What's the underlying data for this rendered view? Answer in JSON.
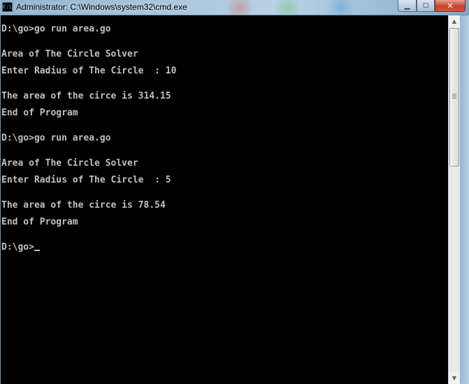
{
  "window": {
    "title": "Administrator: C:\\Windows\\system32\\cmd.exe",
    "icon_text": "C:\\",
    "controls": {
      "minimize": "▁",
      "maximize": "▢",
      "close": "✕"
    }
  },
  "console": {
    "lines": [
      "D:\\go>go run area.go",
      "Area of The Circle Solver",
      "Enter Radius of The Circle  : 10",
      "The area of the circe is 314.15",
      "End of Program",
      "D:\\go>go run area.go",
      "Area of The Circle Solver",
      "Enter Radius of The Circle  : 5",
      "The area of the circe is 78.54",
      "End of Program",
      "D:\\go>"
    ]
  },
  "scrollbar": {
    "up_arrow": "▲",
    "down_arrow": "▼"
  },
  "colors": {
    "console_background": "#000000",
    "console_text": "#c0c0c0",
    "title_bar": "#a9c6dc",
    "close_button": "#c7432c"
  }
}
